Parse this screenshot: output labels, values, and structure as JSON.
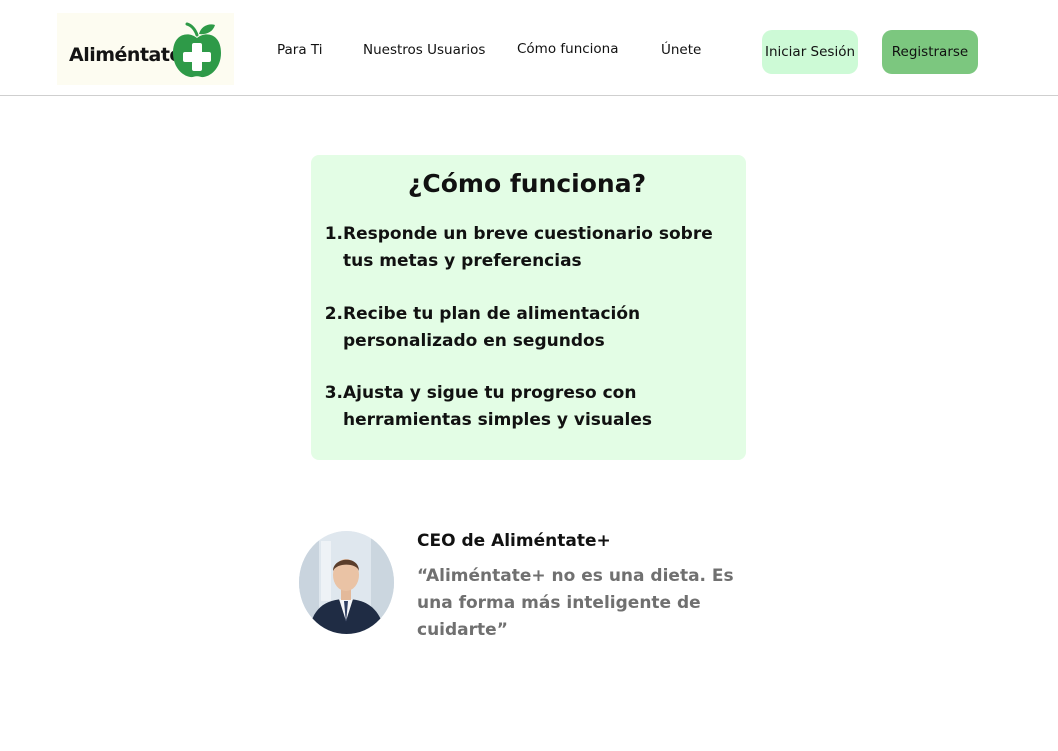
{
  "header": {
    "logo": {
      "text": "Aliméntate",
      "icon": "apple-plus-icon"
    },
    "nav": [
      {
        "label": "Para Ti"
      },
      {
        "label": "Nuestros Usuarios"
      },
      {
        "label": "Cómo funciona"
      },
      {
        "label": "Únete"
      }
    ],
    "login_label": "Iniciar Sesión",
    "register_label": "Registrarse"
  },
  "how_it_works": {
    "title": "¿Cómo funciona?",
    "steps": [
      {
        "number": "1.",
        "text": "Responde un breve cuestionario sobre tus metas y preferencias"
      },
      {
        "number": "2.",
        "text": "Recibe tu plan de alimentación personalizado en segundos"
      },
      {
        "number": "3.",
        "text": "Ajusta y sigue tu progreso con herramientas simples y visuales"
      }
    ]
  },
  "testimonial": {
    "role": "CEO de Aliméntate+",
    "quote": "“Aliméntate+ no es una dieta. Es una forma más inteligente de cuidarte”"
  },
  "colors": {
    "brand_green": "#2e9a48",
    "login_bg": "#cdfad6",
    "register_bg": "#7cc77f",
    "card_bg": "#e3fde5",
    "quote_text": "#707070"
  }
}
